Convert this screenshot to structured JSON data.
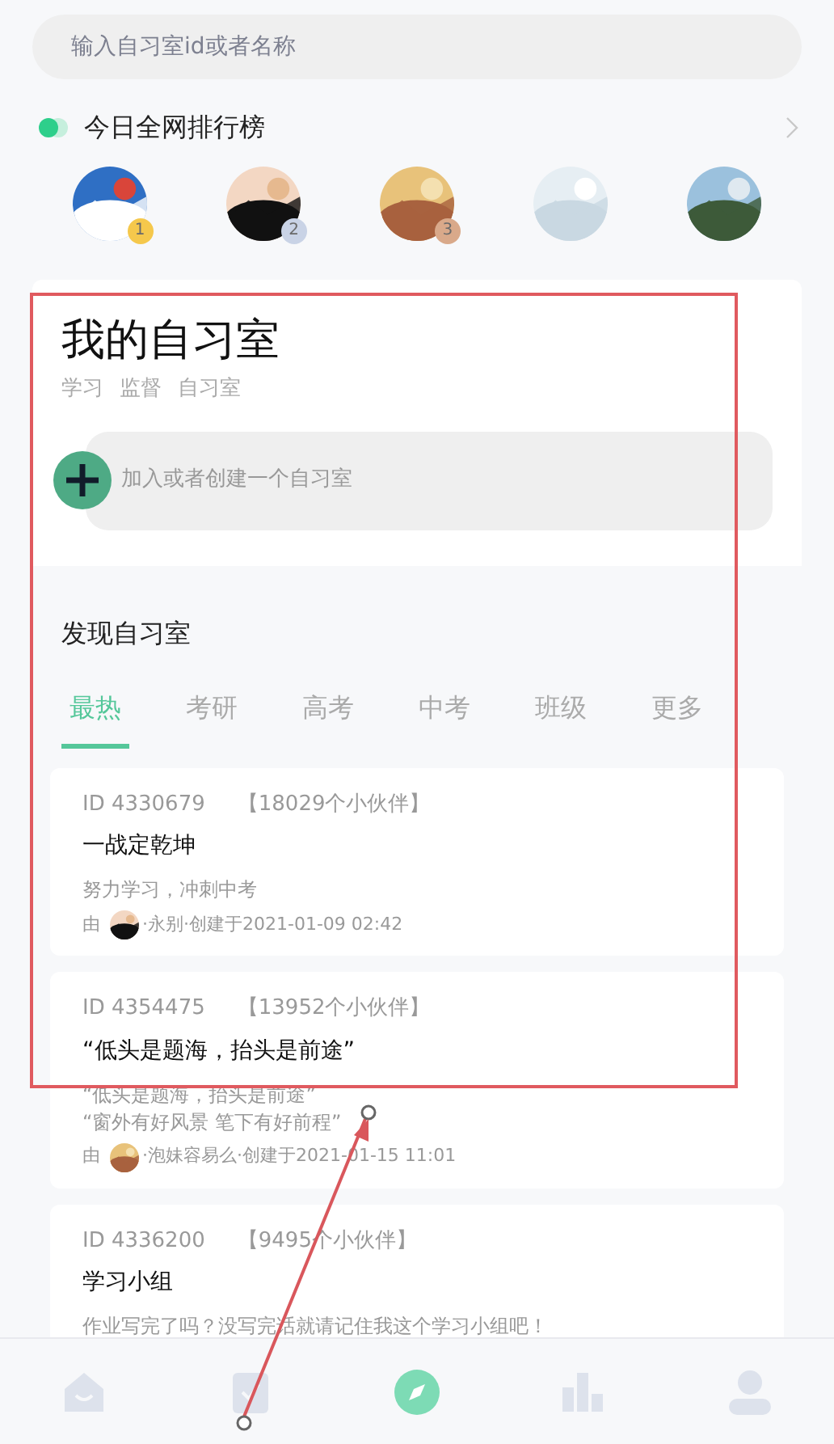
{
  "search": {
    "placeholder": "输入自习室id或者名称"
  },
  "ranking": {
    "title": "今日全网排行榜",
    "avatars": [
      {
        "kind": "picture",
        "medal": "1",
        "color": "#f5c84c"
      },
      {
        "kind": "picture",
        "medal": "2",
        "color": "#c9d3e6"
      },
      {
        "kind": "picture",
        "medal": "3",
        "color": "#d9a98a"
      },
      {
        "kind": "picture"
      },
      {
        "kind": "picture"
      }
    ]
  },
  "my_rooms": {
    "title": "我的自习室",
    "tags": [
      "学习",
      "监督",
      "自习室"
    ],
    "create_placeholder": "加入或者创建一个自习室"
  },
  "discover": {
    "title": "发现自习室",
    "tabs": [
      {
        "label": "最热",
        "selected": true
      },
      {
        "label": "考研",
        "selected": false
      },
      {
        "label": "高考",
        "selected": false
      },
      {
        "label": "中考",
        "selected": false
      },
      {
        "label": "班级",
        "selected": false
      },
      {
        "label": "更多",
        "selected": false
      }
    ],
    "rooms": [
      {
        "id": "ID 4330679",
        "members": "【18029个小伙伴】",
        "name": "一战定乾坤",
        "desc": [
          "努力学习，冲刺中考"
        ],
        "by": "由",
        "creator": "·永别·创建于2021-01-09 02:42"
      },
      {
        "id": "ID 4354475",
        "members": "【13952个小伙伴】",
        "name": "“低头是题海，抬头是前途”",
        "desc": [
          "“低头是题海，抬头是前途”",
          "“窗外有好风景 笔下有好前程”"
        ],
        "by": "由",
        "creator": "·泡妹容易么·创建于2021-01-15 11:01"
      },
      {
        "id": "ID 4336200",
        "members": "【9495个小伙伴】",
        "name": "学习小组",
        "desc": [
          "作业写完了吗？没写完话就请记住我这个学习小组吧！"
        ]
      }
    ]
  },
  "nav": [
    {
      "kind": "home",
      "selected": false
    },
    {
      "kind": "tasks",
      "selected": false
    },
    {
      "kind": "discover",
      "selected": true
    },
    {
      "kind": "stats",
      "selected": false
    },
    {
      "kind": "profile",
      "selected": false
    }
  ]
}
